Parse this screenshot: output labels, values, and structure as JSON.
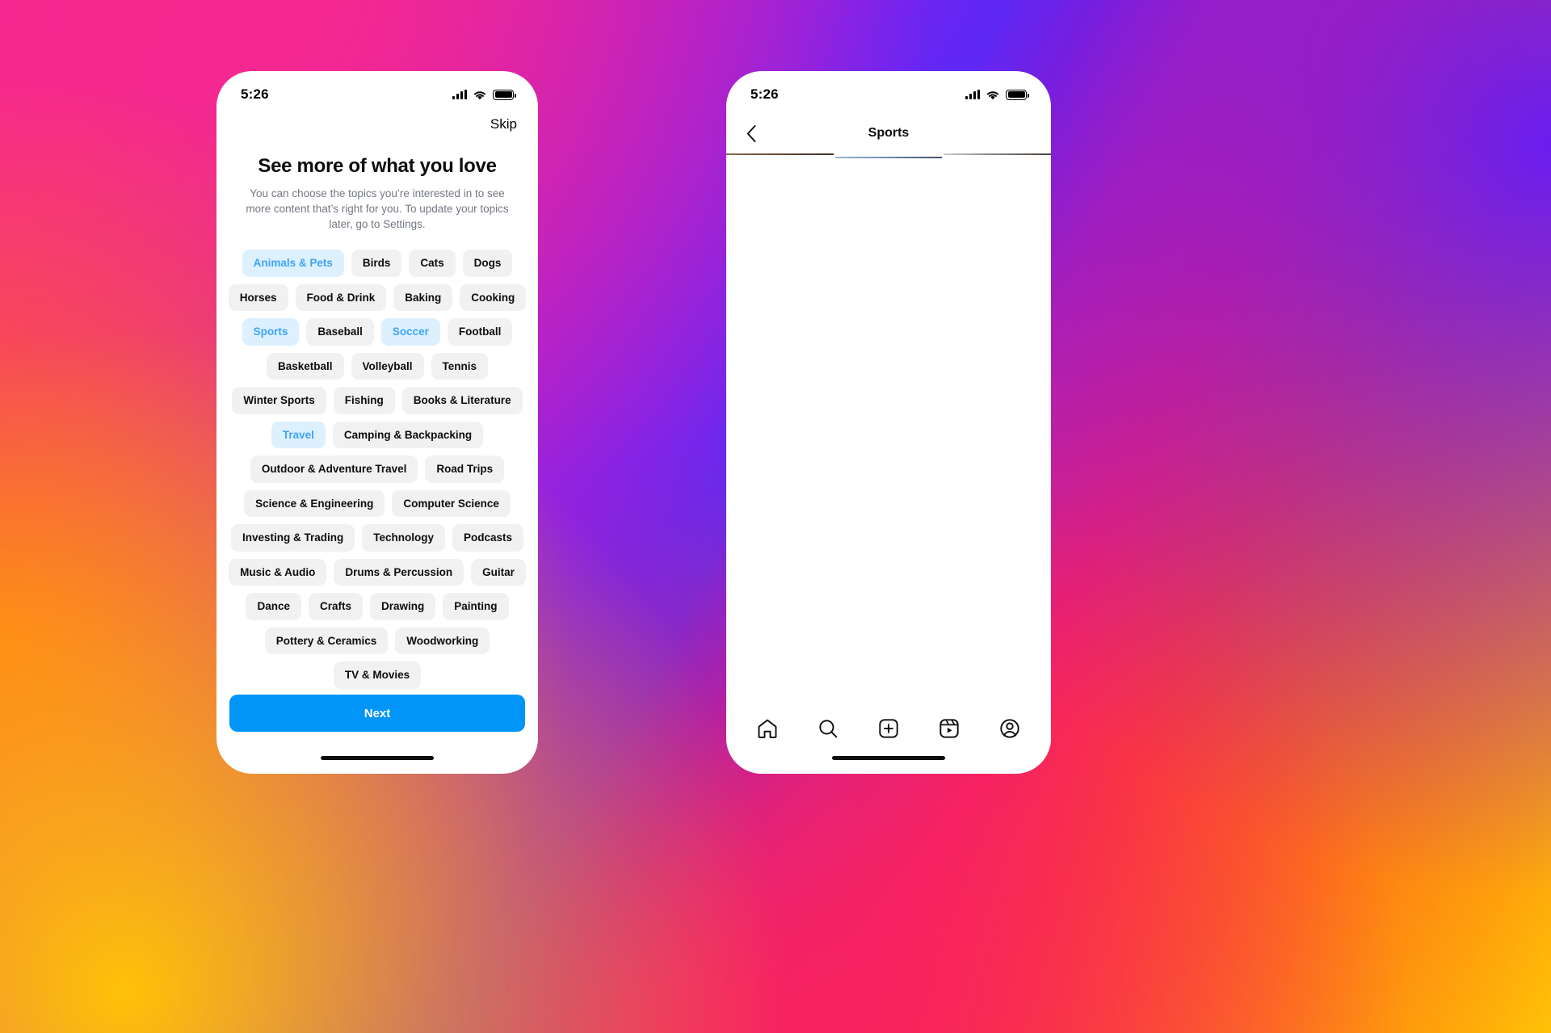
{
  "background": {
    "brand_gradient_colors": [
      "#ffc107",
      "#ff6a1f",
      "#f8235f",
      "#f7288f",
      "#6a1df0"
    ]
  },
  "accent": {
    "primary_blue": "#0095f6",
    "chip_selected_bg": "#ddf0fe",
    "chip_selected_text": "#3fa4f7",
    "chip_bg": "#f1f1f2"
  },
  "left_phone": {
    "status": {
      "time": "5:26",
      "signal_icon": "cellular-bars-icon",
      "wifi_icon": "wifi-icon",
      "battery_icon": "battery-full-icon"
    },
    "skip_label": "Skip",
    "headline": "See more of what you love",
    "subcopy": "You can choose the topics you’re interested in to see more content that’s right for you. To update your topics later, go to Settings.",
    "topics": [
      {
        "label": "Animals & Pets",
        "selected": true
      },
      {
        "label": "Birds",
        "selected": false
      },
      {
        "label": "Cats",
        "selected": false
      },
      {
        "label": "Dogs",
        "selected": false
      },
      {
        "label": "Horses",
        "selected": false
      },
      {
        "label": "Food & Drink",
        "selected": false
      },
      {
        "label": "Baking",
        "selected": false
      },
      {
        "label": "Cooking",
        "selected": false
      },
      {
        "label": "Sports",
        "selected": true
      },
      {
        "label": "Baseball",
        "selected": false
      },
      {
        "label": "Soccer",
        "selected": true
      },
      {
        "label": "Football",
        "selected": false
      },
      {
        "label": "Basketball",
        "selected": false
      },
      {
        "label": "Volleyball",
        "selected": false
      },
      {
        "label": "Tennis",
        "selected": false
      },
      {
        "label": "Winter Sports",
        "selected": false
      },
      {
        "label": "Fishing",
        "selected": false
      },
      {
        "label": "Books & Literature",
        "selected": false
      },
      {
        "label": "Travel",
        "selected": true
      },
      {
        "label": "Camping & Backpacking",
        "selected": false
      },
      {
        "label": "Outdoor & Adventure Travel",
        "selected": false
      },
      {
        "label": "Road Trips",
        "selected": false
      },
      {
        "label": "Science & Engineering",
        "selected": false
      },
      {
        "label": "Computer Science",
        "selected": false
      },
      {
        "label": "Investing & Trading",
        "selected": false
      },
      {
        "label": "Technology",
        "selected": false
      },
      {
        "label": "Podcasts",
        "selected": false
      },
      {
        "label": "Music & Audio",
        "selected": false
      },
      {
        "label": "Drums & Percussion",
        "selected": false
      },
      {
        "label": "Guitar",
        "selected": false
      },
      {
        "label": "Dance",
        "selected": false
      },
      {
        "label": "Crafts",
        "selected": false
      },
      {
        "label": "Drawing",
        "selected": false
      },
      {
        "label": "Painting",
        "selected": false
      },
      {
        "label": "Pottery & Ceramics",
        "selected": false
      },
      {
        "label": "Woodworking",
        "selected": false
      },
      {
        "label": "TV & Movies",
        "selected": false
      }
    ],
    "next_label": "Next"
  },
  "right_phone": {
    "status": {
      "time": "5:26",
      "signal_icon": "cellular-bars-icon",
      "wifi_icon": "wifi-icon",
      "battery_icon": "battery-full-icon"
    },
    "back_icon": "chevron-left-icon",
    "title": "Sports",
    "grid": [
      {
        "id": "post-1",
        "badge": "carousel",
        "style": "p1",
        "span": "tall"
      },
      {
        "id": "post-2",
        "badge": "none",
        "style": "p2",
        "span": "one"
      },
      {
        "id": "post-3",
        "badge": "none",
        "style": "p3",
        "span": "tall"
      },
      {
        "id": "post-4",
        "badge": "none",
        "style": "p4",
        "span": "one"
      },
      {
        "id": "post-5",
        "badge": "carousel",
        "style": "p5",
        "span": "one"
      },
      {
        "id": "post-6",
        "badge": "none",
        "style": "p6",
        "span": "tall"
      },
      {
        "id": "post-7",
        "badge": "reel",
        "style": "p8",
        "span": "one"
      },
      {
        "id": "post-8",
        "badge": "none",
        "style": "p9",
        "span": "one"
      },
      {
        "id": "post-9",
        "badge": "none",
        "style": "p10",
        "span": "one"
      },
      {
        "id": "post-10",
        "badge": "none",
        "style": "p11",
        "span": "one"
      },
      {
        "id": "post-11",
        "badge": "none",
        "style": "p12",
        "span": "one"
      },
      {
        "id": "post-12",
        "badge": "none",
        "style": "p13",
        "span": "one"
      },
      {
        "id": "post-13",
        "badge": "none",
        "style": "p14",
        "span": "one"
      }
    ],
    "tabs": [
      {
        "icon": "home-icon",
        "name": "tab-home"
      },
      {
        "icon": "search-icon",
        "name": "tab-search"
      },
      {
        "icon": "plus-box-icon",
        "name": "tab-create"
      },
      {
        "icon": "reels-icon",
        "name": "tab-reels"
      },
      {
        "icon": "profile-icon",
        "name": "tab-profile"
      }
    ]
  }
}
